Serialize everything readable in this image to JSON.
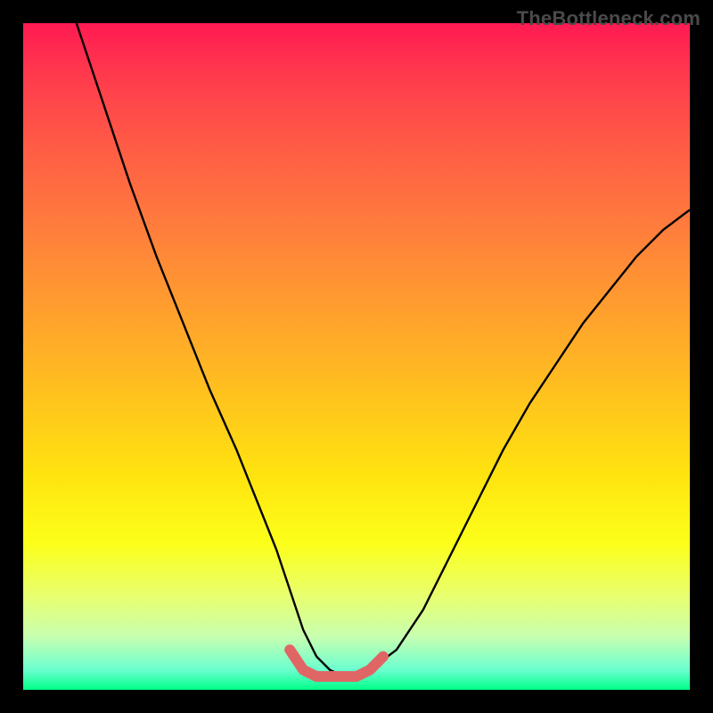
{
  "watermark": "TheBottleneck.com",
  "chart_data": {
    "type": "line",
    "title": "",
    "xlabel": "",
    "ylabel": "",
    "xlim": [
      0,
      100
    ],
    "ylim": [
      0,
      100
    ],
    "series": [
      {
        "name": "main-curve",
        "color": "#000000",
        "x": [
          8,
          12,
          16,
          20,
          24,
          28,
          32,
          34,
          36,
          38,
          40,
          42,
          44,
          46,
          48,
          50,
          52,
          56,
          60,
          64,
          68,
          72,
          76,
          80,
          84,
          88,
          92,
          96,
          100
        ],
        "values": [
          100,
          88,
          76,
          65,
          55,
          45,
          36,
          31,
          26,
          21,
          15,
          9,
          5,
          3,
          2,
          2,
          3,
          6,
          12,
          20,
          28,
          36,
          43,
          49,
          55,
          60,
          65,
          69,
          72
        ]
      },
      {
        "name": "highlight-segment",
        "color": "#e06666",
        "x": [
          40,
          42,
          44,
          46,
          48,
          50,
          52,
          54
        ],
        "values": [
          6,
          3,
          2,
          2,
          2,
          2,
          3,
          5
        ]
      }
    ]
  }
}
